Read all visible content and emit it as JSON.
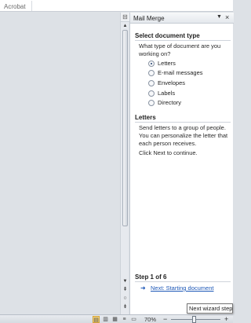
{
  "ribbon": {
    "group_label": "Acrobat"
  },
  "scrollbar": {
    "ruler_icon": "ruler-toggle-icon",
    "up_icon": "scroll-up-arrow-icon",
    "down_icon": "scroll-down-arrow-icon",
    "prev_page_icon": "previous-page-icon",
    "browse_object_icon": "select-browse-object-icon",
    "next_page_icon": "next-page-icon"
  },
  "pane": {
    "title": "Mail Merge",
    "menu_glyph": "▼",
    "close_glyph": "×",
    "select_heading": "Select document type",
    "question": "What type of document are you working on?",
    "options": [
      {
        "label": "Letters",
        "selected": true
      },
      {
        "label": "E-mail messages",
        "selected": false
      },
      {
        "label": "Envelopes",
        "selected": false
      },
      {
        "label": "Labels",
        "selected": false
      },
      {
        "label": "Directory",
        "selected": false
      }
    ],
    "letters_heading": "Letters",
    "letters_description": "Send letters to a group of people. You can personalize the letter that each person receives.",
    "click_next": "Click Next to continue.",
    "step": "Step 1 of 6",
    "next_arrow_glyph": "➜",
    "next_link": "Next: Starting document"
  },
  "status_bar": {
    "zoom": "70%",
    "zoom_minus": "−",
    "zoom_plus": "+",
    "zoom_level_percent": 70
  },
  "tooltip": "Next wizard step",
  "colors": {
    "link": "#1c57b7",
    "active_view": "#f8d67d",
    "background": "#dde1e6"
  }
}
